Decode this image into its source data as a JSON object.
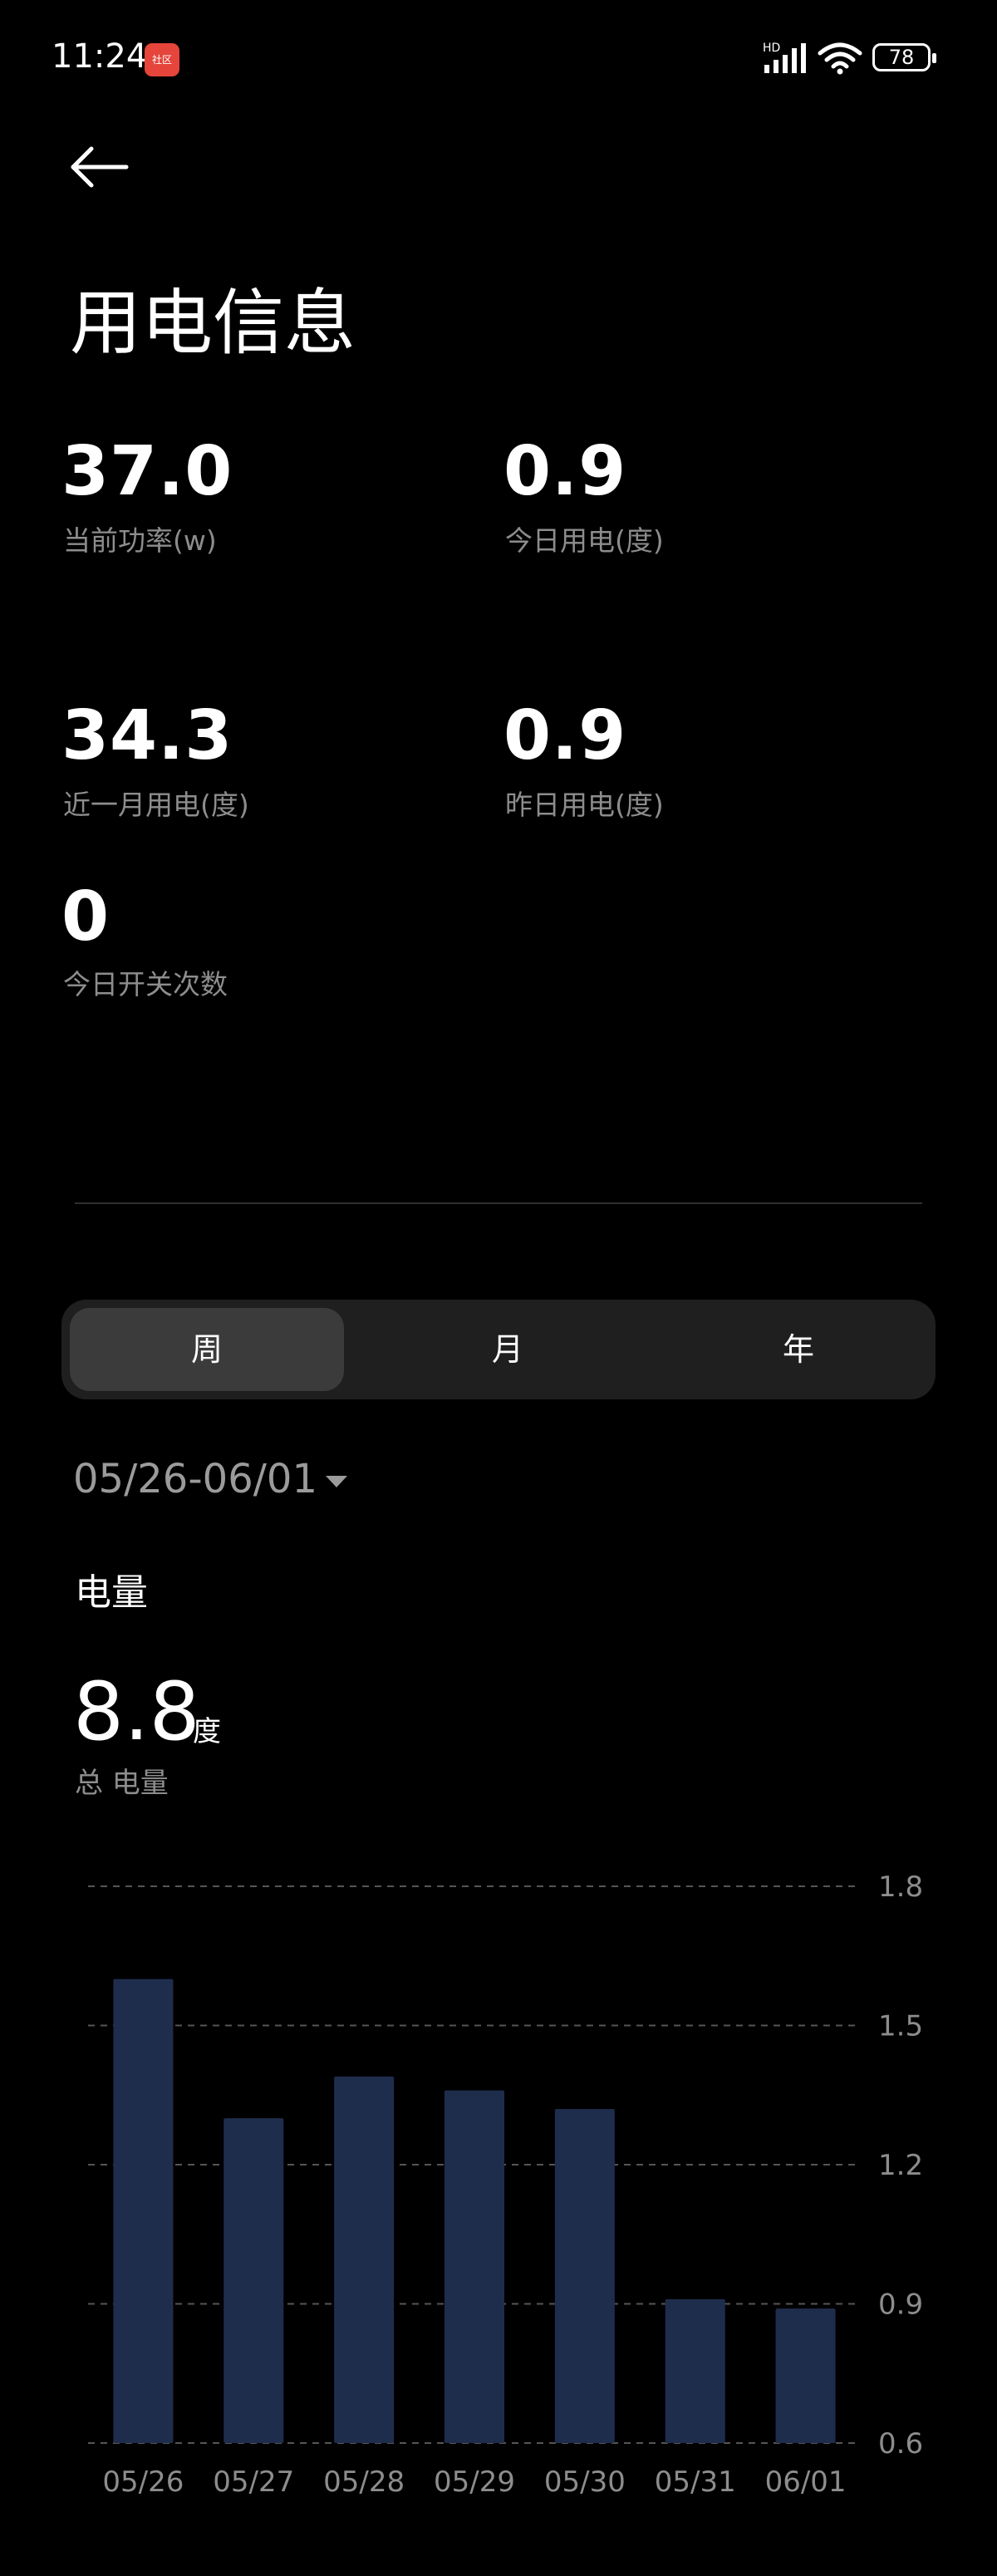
{
  "status_bar": {
    "time": "11:24",
    "notification_badge": "社区",
    "network": "HD",
    "battery": "78"
  },
  "page": {
    "title": "用电信息"
  },
  "metrics": [
    {
      "value": "37.0",
      "label": "当前功率(w)"
    },
    {
      "value": "0.9",
      "label": "今日用电(度)"
    },
    {
      "value": "34.3",
      "label": "近一月用电(度)"
    },
    {
      "value": "0.9",
      "label": "昨日用电(度)"
    },
    {
      "value": "0",
      "label": "今日开关次数"
    }
  ],
  "tabs": [
    {
      "label": "周",
      "active": true
    },
    {
      "label": "月",
      "active": false
    },
    {
      "label": "年",
      "active": false
    }
  ],
  "date_range": "05/26-06/01",
  "energy": {
    "section_title": "电量",
    "total_value": "8.8",
    "total_unit": "度",
    "total_label": "总 电量"
  },
  "colors": {
    "background": "#000000",
    "bar": "#1f2d4d",
    "grid": "#555555",
    "muted_text": "#8d8d8d"
  },
  "chart_data": {
    "type": "bar",
    "categories": [
      "05/26",
      "05/27",
      "05/28",
      "05/29",
      "05/30",
      "05/31",
      "06/01"
    ],
    "values": [
      1.6,
      1.3,
      1.39,
      1.36,
      1.32,
      0.91,
      0.89
    ],
    "ylim": [
      0.6,
      1.8
    ],
    "yticks": [
      "1.8",
      "1.5",
      "1.2",
      "0.9",
      "0.6"
    ],
    "title": "",
    "xlabel": "",
    "ylabel": "",
    "grid": true,
    "grid_style": "dashed",
    "axis_position": "right"
  }
}
